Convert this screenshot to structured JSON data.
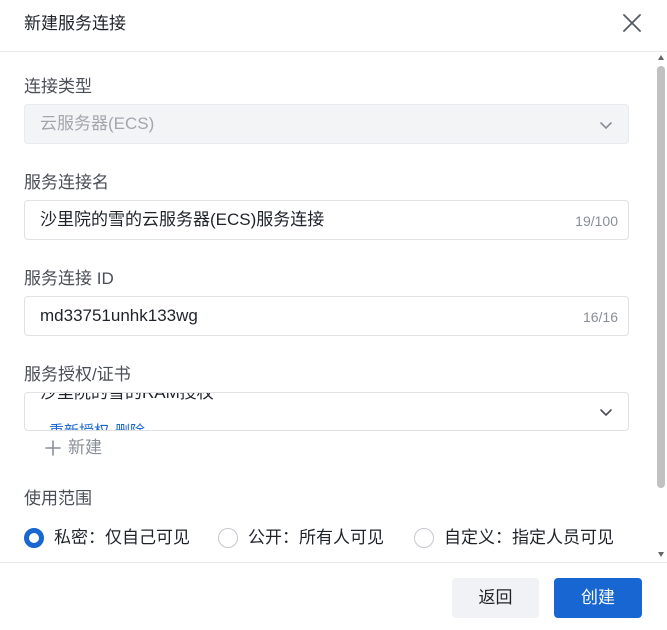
{
  "dialog": {
    "title": "新建服务连接"
  },
  "form": {
    "connection_type": {
      "label": "连接类型",
      "value": "云服务器(ECS)"
    },
    "connection_name": {
      "label": "服务连接名",
      "value": "沙里院的雪的云服务器(ECS)服务连接",
      "counter": "19/100"
    },
    "connection_id": {
      "label": "服务连接 ID",
      "value": "md33751unhk133wg",
      "counter": "16/16"
    },
    "authorization": {
      "label": "服务授权/证书",
      "selected": "沙里院的雪的RAM授权",
      "reauthorize_label": "重新授权",
      "delete_label": "删除",
      "new_label": "新建"
    },
    "scope": {
      "label": "使用范围",
      "options": [
        {
          "label": "私密：仅自己可见",
          "checked": true
        },
        {
          "label": "公开：所有人可见",
          "checked": false
        },
        {
          "label": "自定义：指定人员可见",
          "checked": false
        }
      ]
    }
  },
  "footer": {
    "back_label": "返回",
    "create_label": "创建"
  },
  "colors": {
    "accent": "#1766d1",
    "border": "#dfe1e5",
    "disabled_bg": "#f2f4f6"
  }
}
